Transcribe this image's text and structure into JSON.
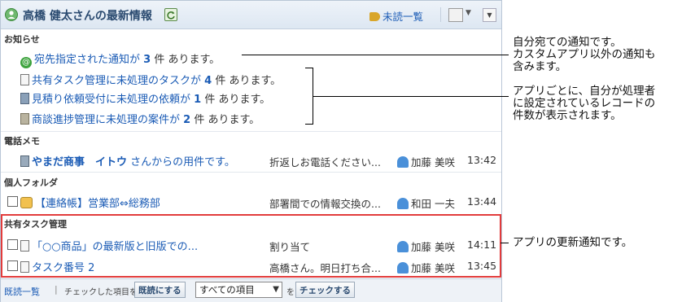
{
  "header": {
    "title": "高橋 健太さんの最新情報",
    "unread_label": "未読一覧"
  },
  "sections": {
    "notice": "お知らせ",
    "phone": "電話メモ",
    "folder": "個人フォルダ",
    "shared": "共有タスク管理"
  },
  "notices": [
    {
      "pre": "宛先指定された通知が",
      "count": "3",
      "post": "件 あります。"
    },
    {
      "pre": "共有タスク管理に未処理のタスクが",
      "count": "4",
      "post": "件 あります。"
    },
    {
      "pre": "見積り依頼受付に未処理の依頼が",
      "count": "1",
      "post": "件 あります。"
    },
    {
      "pre": "商談進捗管理に未処理の案件が",
      "count": "2",
      "post": "件 あります。"
    }
  ],
  "phone_memo": {
    "title_bold": "やまだ商事　イトウ",
    "title_rest": " さんからの用件です。",
    "preview": "折返しお電話ください...",
    "person": "加藤 美咲",
    "time": "13:42"
  },
  "folder_item": {
    "title": "【連絡帳】営業部⇔総務部",
    "preview": "部署間での情報交換の...",
    "person": "和田 一夫",
    "time": "13:44"
  },
  "shared_items": [
    {
      "title": "「○○商品」の最新版と旧版での...",
      "preview": "割り当て",
      "person": "加藤 美咲",
      "time": "14:11"
    },
    {
      "title": "タスク番号 2",
      "preview": "高橋さん。明日打ち合...",
      "person": "加藤 美咲",
      "time": "13:45"
    }
  ],
  "footer": {
    "read_list": "既読一覧",
    "checked_label": "チェックした項目を",
    "mark_read": "既読にする",
    "select_value": "すべての項目",
    "wo": "を",
    "check_button": "チェックする"
  },
  "callouts": {
    "c1_l1": "自分宛ての通知です。",
    "c1_l2": "カスタムアプリ以外の通知も",
    "c1_l3": "含みます。",
    "c2_l1": "アプリごとに、自分が処理者",
    "c2_l2": "に設定されているレコードの",
    "c2_l3": "件数が表示されます。",
    "c3": "アプリの更新通知です。"
  },
  "colors": {
    "link": "#1a5bb5",
    "highlight": "#e23c3c",
    "header_bg": "#dde7f2"
  }
}
